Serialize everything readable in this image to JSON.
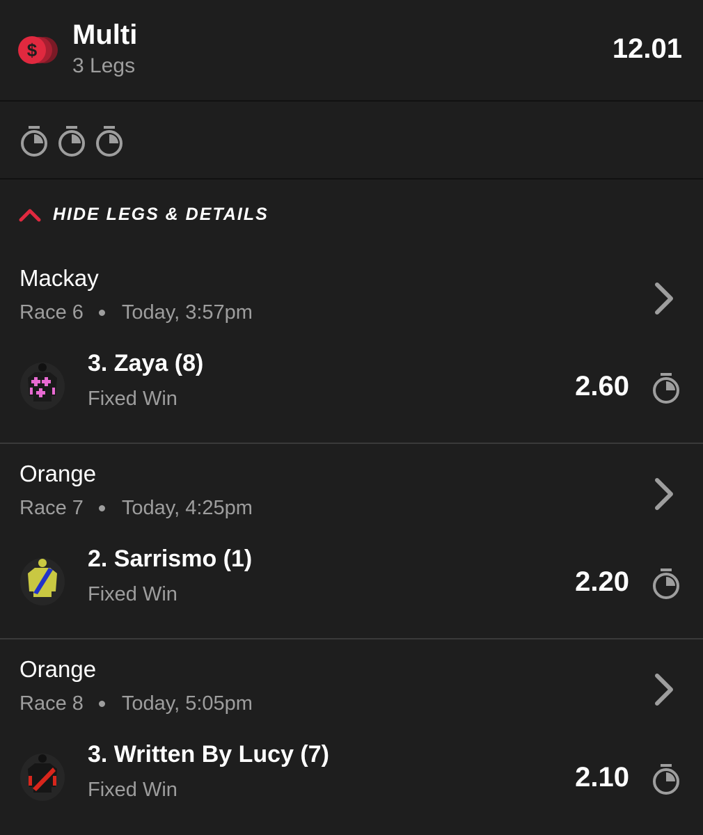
{
  "header": {
    "title": "Multi",
    "subtitle": "3 Legs",
    "total_odds": "12.01",
    "icon": "dollar-coins-icon",
    "accent_color": "#e0293f"
  },
  "status": {
    "icons": [
      "timer-icon",
      "timer-icon",
      "timer-icon"
    ]
  },
  "toggle": {
    "label": "HIDE LEGS & DETAILS",
    "icon": "chevron-up-icon"
  },
  "legs": [
    {
      "venue": "Mackay",
      "race": "Race 6",
      "time": "Today, 3:57pm",
      "runner": "3. Zaya (8)",
      "bet_type": "Fixed Win",
      "odds": "2.60",
      "silk": {
        "body": "#1a1a1a",
        "accent": "#e86ad2",
        "pattern": "crosses"
      }
    },
    {
      "venue": "Orange",
      "race": "Race 7",
      "time": "Today, 4:25pm",
      "runner": "2. Sarrismo (1)",
      "bet_type": "Fixed Win",
      "odds": "2.20",
      "silk": {
        "body": "#c9c842",
        "accent": "#2233c8",
        "pattern": "sash"
      }
    },
    {
      "venue": "Orange",
      "race": "Race 8",
      "time": "Today, 5:05pm",
      "runner": "3. Written By Lucy (7)",
      "bet_type": "Fixed Win",
      "odds": "2.10",
      "silk": {
        "body": "#161616",
        "accent": "#d8261c",
        "pattern": "sash"
      }
    }
  ]
}
